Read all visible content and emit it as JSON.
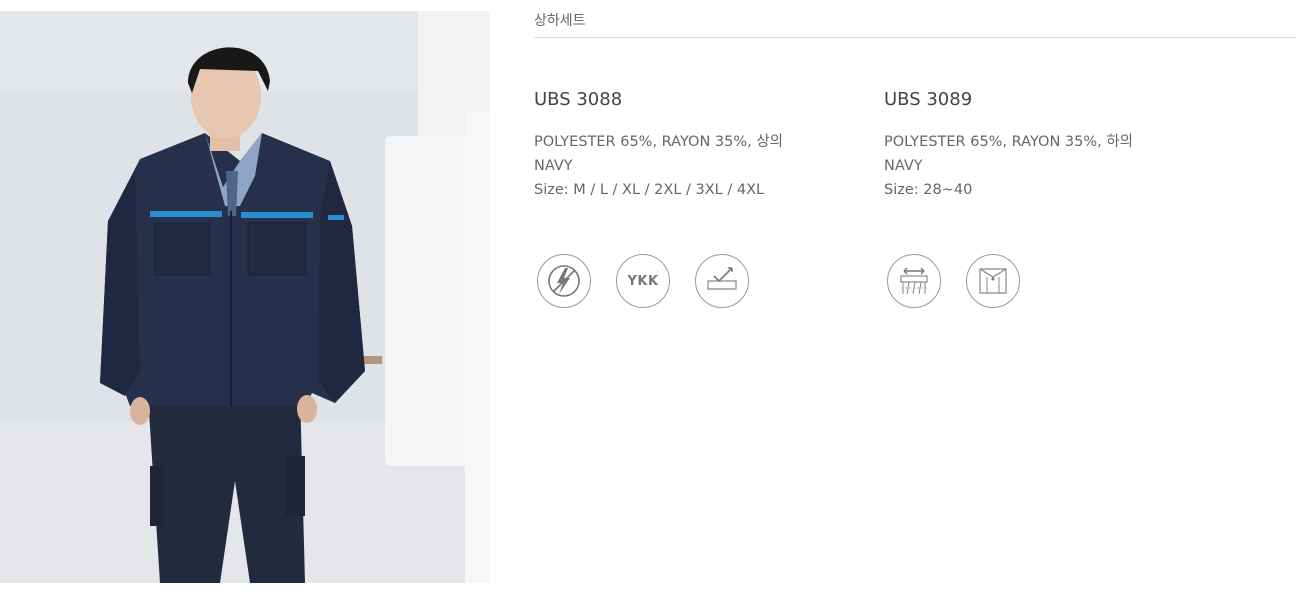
{
  "category": {
    "title": "상하세트"
  },
  "products": [
    {
      "code": "UBS 3088",
      "material": "POLYESTER 65%, RAYON 35%, 상의",
      "color": "NAVY",
      "size": "Size: M / L / XL / 2XL / 3XL / 4XL",
      "features": [
        {
          "icon": "antistatic-icon"
        },
        {
          "icon": "ykk-zipper-icon",
          "label": "YKK"
        },
        {
          "icon": "durability-check-icon"
        }
      ]
    },
    {
      "code": "UBS 3089",
      "material": "POLYESTER 65%, RAYON 35%, 하의",
      "color": "NAVY",
      "size": "Size: 28~40",
      "features": [
        {
          "icon": "stretch-waistband-icon"
        },
        {
          "icon": "pocket-icon"
        }
      ]
    }
  ],
  "colors": {
    "navy": "#232d42",
    "accent_blue": "#2a8fd0",
    "divider": "#dcdcdc"
  }
}
